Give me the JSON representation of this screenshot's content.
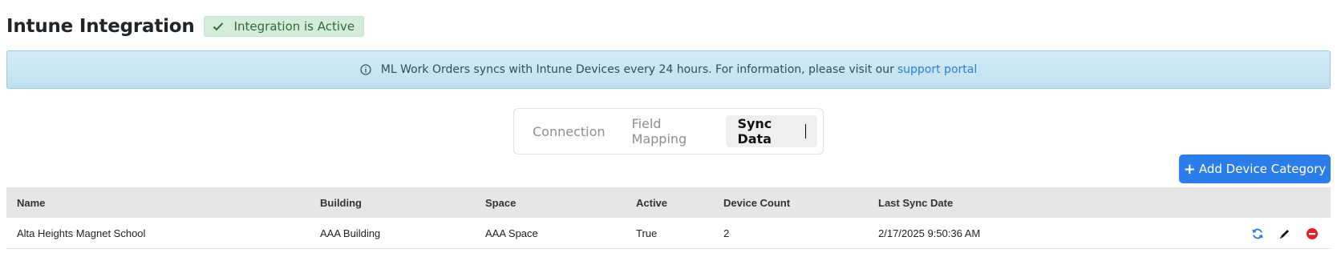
{
  "header": {
    "title": "Intune Integration",
    "status_badge": "Integration is Active"
  },
  "banner": {
    "message": "ML Work Orders syncs with Intune Devices every 24 hours. For information, please visit our",
    "link_label": "support portal"
  },
  "tabs": [
    {
      "label": "Connection",
      "active": false
    },
    {
      "label": "Field Mapping",
      "active": false
    },
    {
      "label": "Sync Data",
      "active": true
    }
  ],
  "toolbar": {
    "add_label": "Add Device Category"
  },
  "table": {
    "columns": [
      "Name",
      "Building",
      "Space",
      "Active",
      "Device Count",
      "Last Sync Date"
    ],
    "rows": [
      {
        "name": "Alta Heights Magnet School",
        "building": "AAA Building",
        "space": "AAA Space",
        "active": "True",
        "device_count": "2",
        "last_sync": "2/17/2025 9:50:36 AM",
        "actions": [
          "sync-icon",
          "edit-icon",
          "delete-icon"
        ]
      }
    ]
  },
  "colors": {
    "accent": "#2b7de9",
    "success_bg": "#d4edda",
    "info_bg": "#d4ebf7",
    "danger": "#e0242b"
  }
}
